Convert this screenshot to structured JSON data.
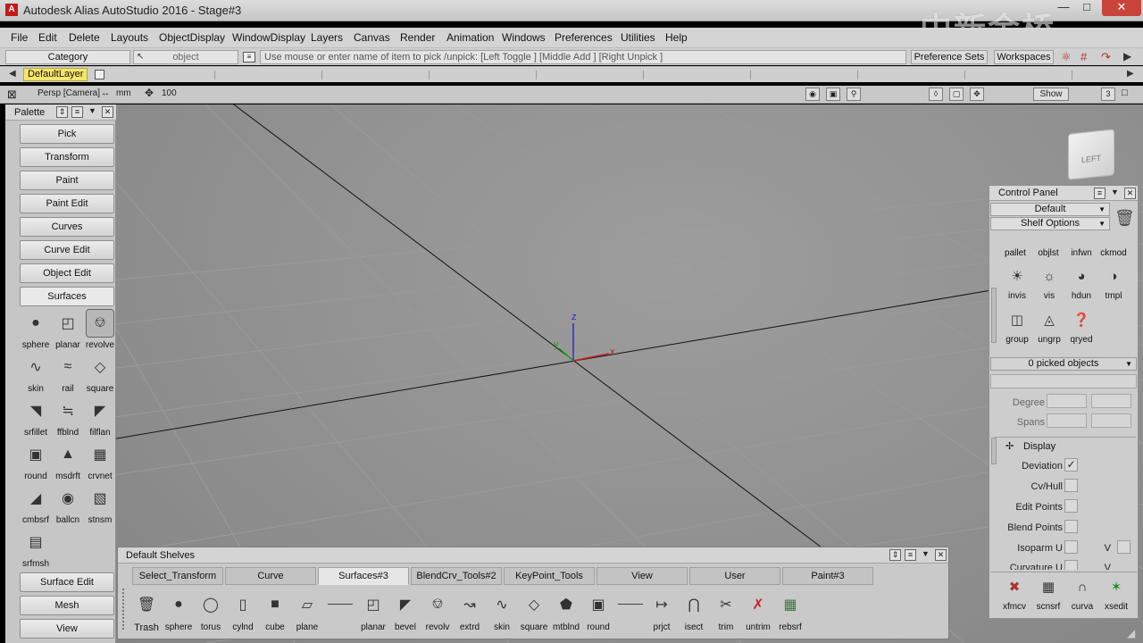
{
  "titlebar": {
    "app_icon": "A",
    "title": "Autodesk Alias AutoStudio 2016    - Stage#3",
    "minimize_icon": "minimize-icon",
    "maximize_icon": "maximize-icon",
    "close_icon": "close-icon"
  },
  "watermark": "中新金桥",
  "menu": {
    "items": [
      "File",
      "Edit",
      "Delete",
      "Layouts",
      "ObjectDisplay",
      "WindowDisplay",
      "Layers",
      "Canvas",
      "Render",
      "Animation",
      "Windows",
      "Preferences",
      "Utilities",
      "Help"
    ]
  },
  "statusrow": {
    "category": "Category",
    "object": "object",
    "prompt": "Use mouse or enter name of item to pick /unpick: [Left Toggle ] [Middle Add ] [Right Unpick ]",
    "preference_sets": "Preference Sets",
    "workspaces": "Workspaces"
  },
  "layerrow": {
    "default_layer": "DefaultLayer"
  },
  "viewbar": {
    "camera": "Persp [Camera]",
    "units": "mm",
    "grid_value": "100",
    "show": "Show",
    "layout_count": "3"
  },
  "palette": {
    "title": "Palette",
    "buttons_top": [
      "Pick",
      "Transform",
      "Paint",
      "Paint Edit",
      "Curves",
      "Curve Edit",
      "Object Edit",
      "Surfaces"
    ],
    "tools": [
      "sphere",
      "planar",
      "revolve",
      "skin",
      "rail",
      "square",
      "srfillet",
      "ffblnd",
      "filflan",
      "round",
      "msdrft",
      "crvnet",
      "cmbsrf",
      "ballcn",
      "stnsm",
      "srfmsh"
    ],
    "buttons_bottom": [
      "Surface Edit",
      "Mesh",
      "View"
    ]
  },
  "viewport": {
    "axis_x": "x",
    "axis_y": "y",
    "axis_z": "z",
    "viewcube": "LEFT"
  },
  "control_panel": {
    "title": "Control Panel",
    "preset": "Default",
    "shelf_options": "Shelf Options",
    "tools_row1": [
      "pallet",
      "objlst",
      "infwn",
      "ckmod"
    ],
    "tools_row2": [
      "invis",
      "vis",
      "hdun",
      "tmpl"
    ],
    "tools_row3": [
      "group",
      "ungrp",
      "qryed"
    ],
    "picked": "0 picked objects",
    "degree_label": "Degree",
    "spans_label": "Spans",
    "display_section": "Display",
    "deviation": "Deviation",
    "cv_hull": "Cv/Hull",
    "edit_points": "Edit Points",
    "blend_points": "Blend Points",
    "isoparm_u": "Isoparm U",
    "v_label": "V",
    "curvature_u": "Curvature U",
    "bottom_tools": [
      "xfmcv",
      "scnsrf",
      "curva",
      "xsedit"
    ]
  },
  "shelves": {
    "title": "Default Shelves",
    "tabs": [
      "Select_Transform",
      "Curve",
      "Surfaces#3",
      "BlendCrv_Tools#2",
      "KeyPoint_Tools",
      "View",
      "User",
      "Paint#3"
    ],
    "active_tab": "Surfaces#3",
    "tools": [
      "Trash",
      "sphere",
      "torus",
      "cylnd",
      "cube",
      "plane",
      "planar",
      "bevel",
      "revolv",
      "extrd",
      "skin",
      "square",
      "mtblnd",
      "round",
      "prjct",
      "isect",
      "trim",
      "untrim",
      "rebsrf"
    ]
  },
  "colors": {
    "viewport_bg": "#8f8f8f",
    "layer_highlight": "#f4e66a",
    "axis_x": "#c81e1e",
    "axis_y": "#1f9a1f",
    "axis_z": "#2a2ad0"
  }
}
